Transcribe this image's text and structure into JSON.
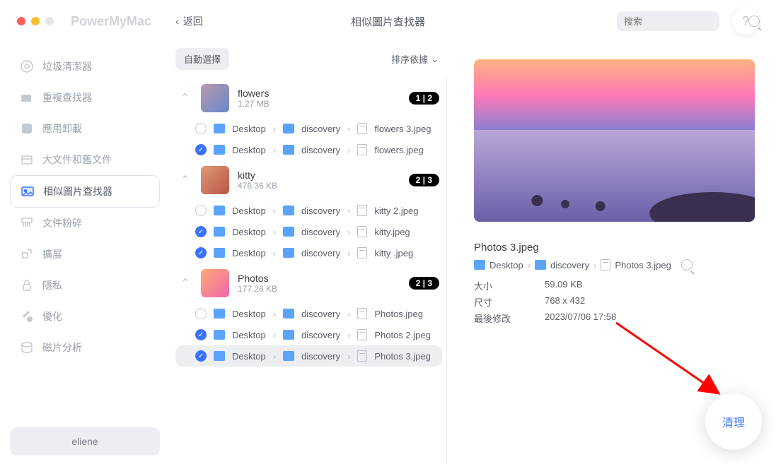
{
  "app_name": "PowerMyMac",
  "back_label": "返回",
  "page_title": "相似圖片查找器",
  "search_placeholder": "搜索",
  "help_label": "?",
  "sidebar": {
    "items": [
      {
        "label": "垃圾清潔器",
        "icon": "target"
      },
      {
        "label": "重複查找器",
        "icon": "folders"
      },
      {
        "label": "應用卸載",
        "icon": "app"
      },
      {
        "label": "大文件和舊文件",
        "icon": "box"
      },
      {
        "label": "相似圖片查找器",
        "icon": "image"
      },
      {
        "label": "文件粉碎",
        "icon": "shred"
      },
      {
        "label": "擴展",
        "icon": "ext"
      },
      {
        "label": "隱私",
        "icon": "lock"
      },
      {
        "label": "優化",
        "icon": "tool"
      },
      {
        "label": "磁片分析",
        "icon": "disk"
      }
    ]
  },
  "user_name": "eliene",
  "toolbar": {
    "auto_select": "自動選擇",
    "sort_by": "排序依據"
  },
  "groups": [
    {
      "title": "flowers",
      "size": "1.27 MB",
      "badge": "1 | 2",
      "files": [
        {
          "checked": false,
          "path1": "Desktop",
          "path2": "discovery",
          "name": "flowers 3.jpeg"
        },
        {
          "checked": true,
          "path1": "Desktop",
          "path2": "discovery",
          "name": "flowers.jpeg"
        }
      ]
    },
    {
      "title": "kitty",
      "size": "476.36 KB",
      "badge": "2 | 3",
      "files": [
        {
          "checked": false,
          "path1": "Desktop",
          "path2": "discovery",
          "name": "kitty 2.jpeg"
        },
        {
          "checked": true,
          "path1": "Desktop",
          "path2": "discovery",
          "name": "kitty.jpeg"
        },
        {
          "checked": true,
          "path1": "Desktop",
          "path2": "discovery",
          "name": "kitty .jpeg"
        }
      ]
    },
    {
      "title": "Photos",
      "size": "177.26 KB",
      "badge": "2 | 3",
      "files": [
        {
          "checked": false,
          "path1": "Desktop",
          "path2": "discovery",
          "name": "Photos.jpeg"
        },
        {
          "checked": true,
          "path1": "Desktop",
          "path2": "discovery",
          "name": "Photos 2.jpeg"
        },
        {
          "checked": true,
          "path1": "Desktop",
          "path2": "discovery",
          "name": "Photos 3.jpeg",
          "selected": true
        }
      ]
    }
  ],
  "preview": {
    "filename": "Photos 3.jpeg",
    "path1": "Desktop",
    "path2": "discovery",
    "path3": "Photos 3.jpeg",
    "size_label": "大小",
    "size_value": "59.09 KB",
    "dim_label": "尺寸",
    "dim_value": "768 x 432",
    "mod_label": "最後修改",
    "mod_value": "2023/07/06 17:58"
  },
  "clean_label": "清理",
  "sep": "›"
}
